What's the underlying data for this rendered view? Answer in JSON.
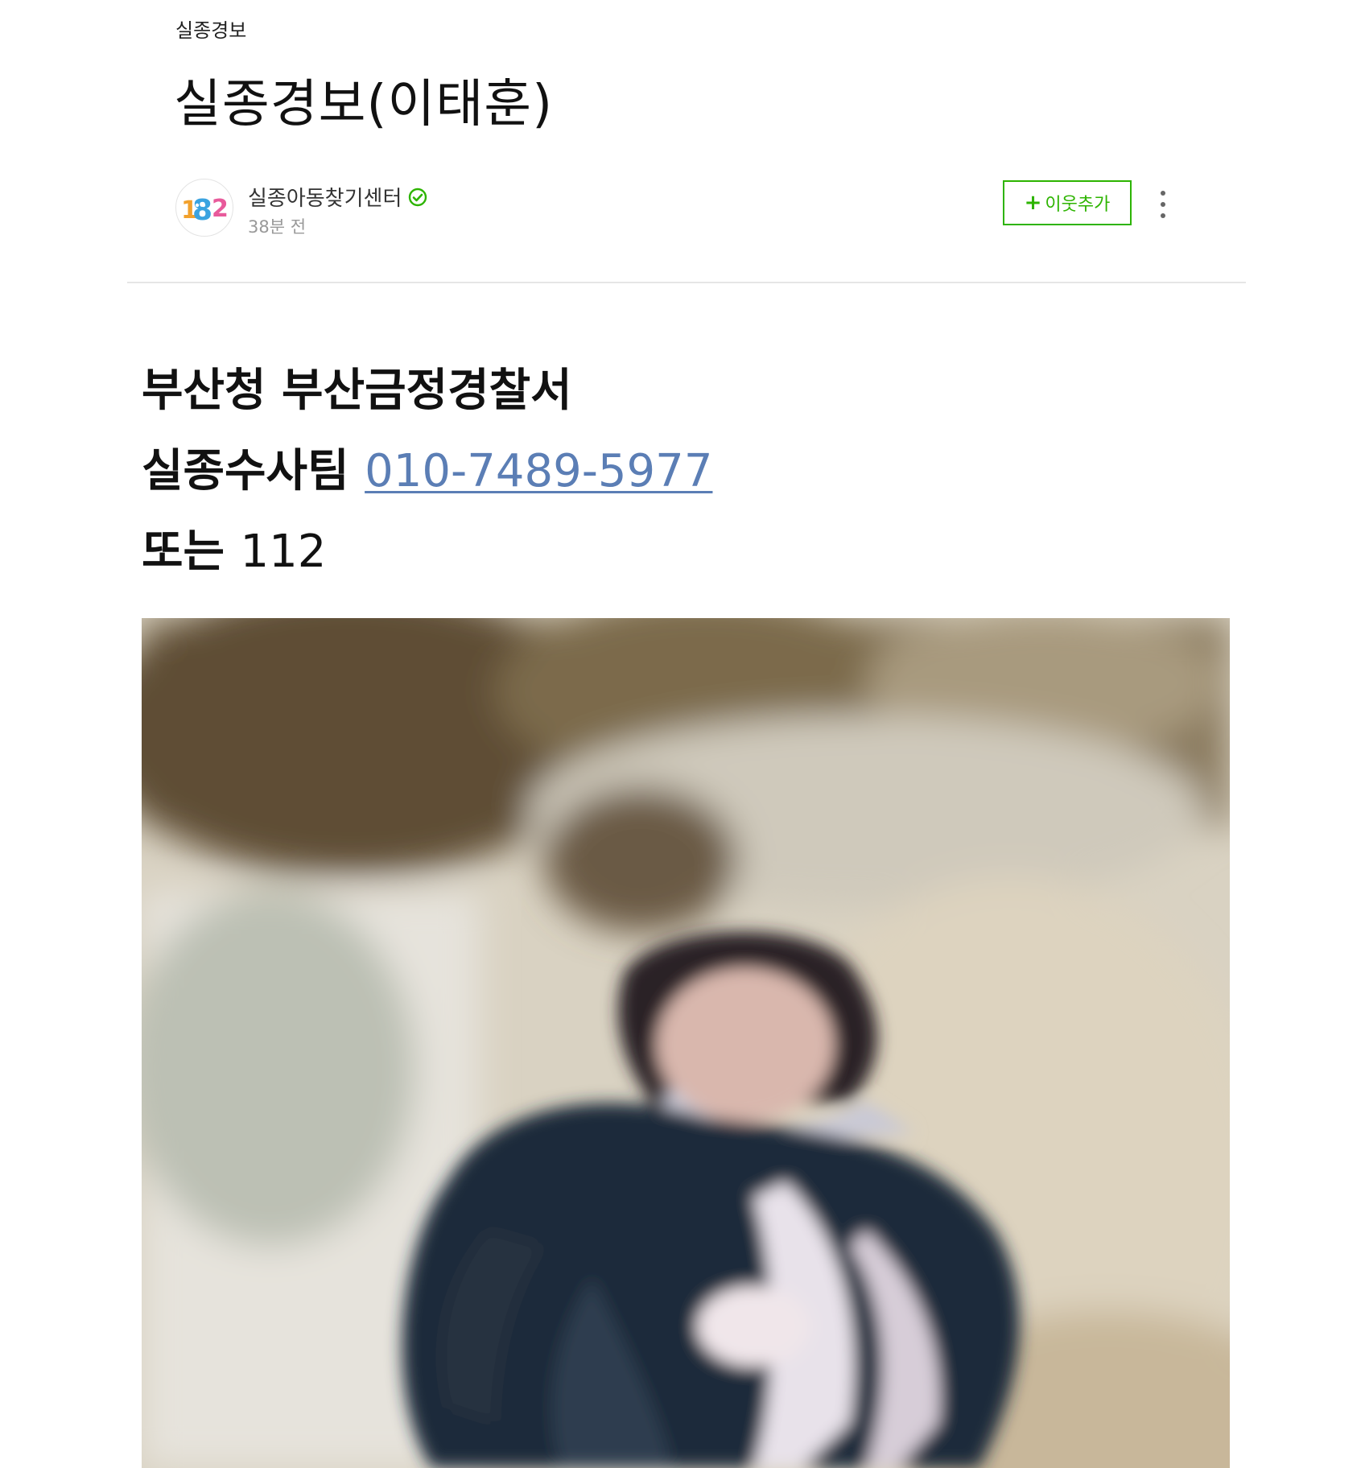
{
  "post": {
    "category": "실종경보",
    "title": "실종경보(이태훈)"
  },
  "author": {
    "avatar_text": "182",
    "name": "실종아동찾기센터",
    "verified_icon": "check-circle-icon",
    "time": "38분 전"
  },
  "actions": {
    "follow_plus": "+",
    "follow_label": "이웃추가",
    "more_icon": "vertical-dots-icon"
  },
  "body": {
    "line1": "부산청 부산금정경찰서",
    "line2_prefix": "실종수사팀",
    "phone": "010-7489-5977",
    "line3_prefix": "또는",
    "line3_number": "112"
  },
  "colors": {
    "accent_green": "#2db400",
    "link_blue": "#5b7eb5",
    "divider": "#e6e6e6"
  }
}
